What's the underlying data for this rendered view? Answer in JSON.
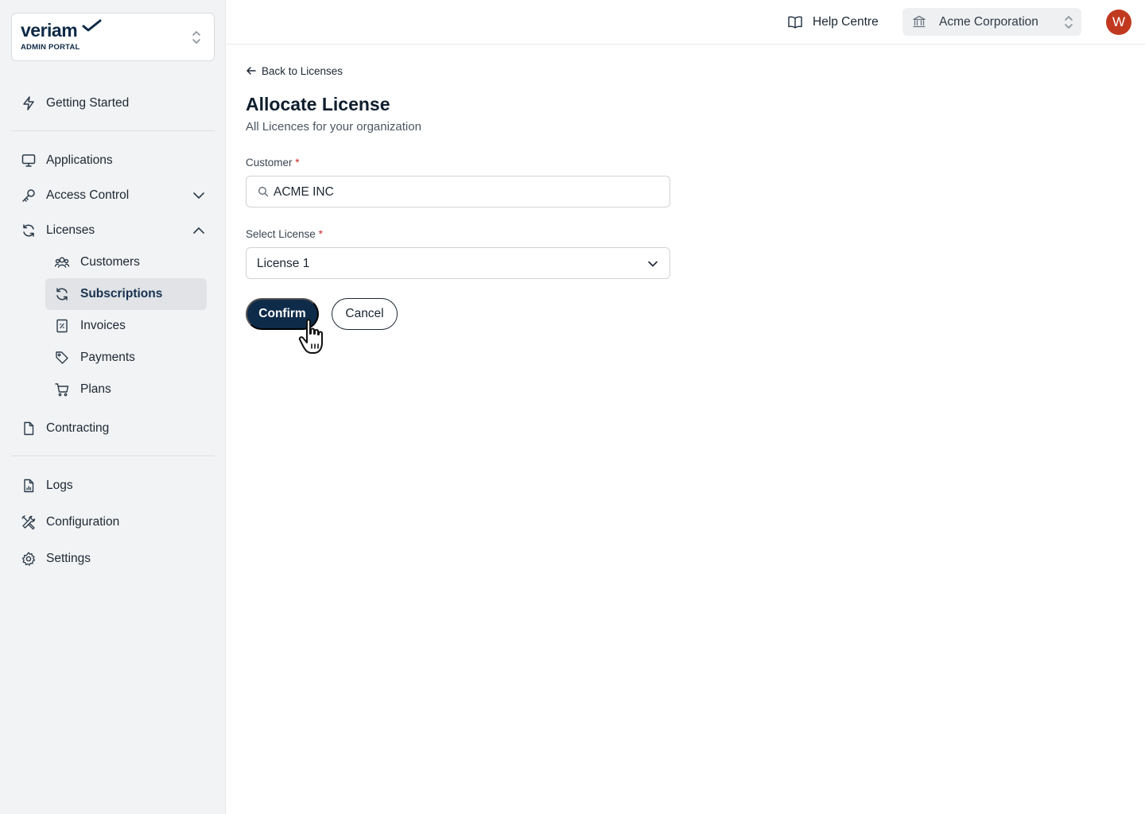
{
  "brand": {
    "name": "veriam",
    "subtitle": "ADMIN PORTAL"
  },
  "sidebar": {
    "items": [
      {
        "label": "Getting Started",
        "icon": "lightning-icon"
      },
      {
        "label": "Applications",
        "icon": "monitor-icon"
      },
      {
        "label": "Access Control",
        "icon": "key-icon",
        "expanded": false
      },
      {
        "label": "Licenses",
        "icon": "refresh-icon",
        "expanded": true
      },
      {
        "label": "Contracting",
        "icon": "document-icon"
      },
      {
        "label": "Logs",
        "icon": "report-icon"
      },
      {
        "label": "Configuration",
        "icon": "tools-icon"
      },
      {
        "label": "Settings",
        "icon": "gear-icon"
      }
    ],
    "license_sub_items": [
      {
        "label": "Customers",
        "icon": "users-icon",
        "active": false
      },
      {
        "label": "Subscriptions",
        "icon": "refresh-icon",
        "active": true
      },
      {
        "label": "Invoices",
        "icon": "receipt-icon",
        "active": false
      },
      {
        "label": "Payments",
        "icon": "tag-icon",
        "active": false
      },
      {
        "label": "Plans",
        "icon": "cart-icon",
        "active": false
      }
    ]
  },
  "topbar": {
    "help_label": "Help Centre",
    "org_label": "Acme Corporation",
    "avatar_initial": "W"
  },
  "main": {
    "back_label": "Back to Licenses",
    "title": "Allocate License",
    "subtitle": "All Licences for your organization",
    "customer_label": "Customer",
    "customer_value": "ACME INC",
    "license_label": "Select License",
    "license_value": "License 1",
    "required_mark": "*",
    "confirm_label": "Confirm",
    "cancel_label": "Cancel"
  },
  "colors": {
    "primary": "#0f2b4a",
    "sidebar_bg": "#f2f3f4",
    "avatar": "#c0391f",
    "required": "#c8292d"
  }
}
